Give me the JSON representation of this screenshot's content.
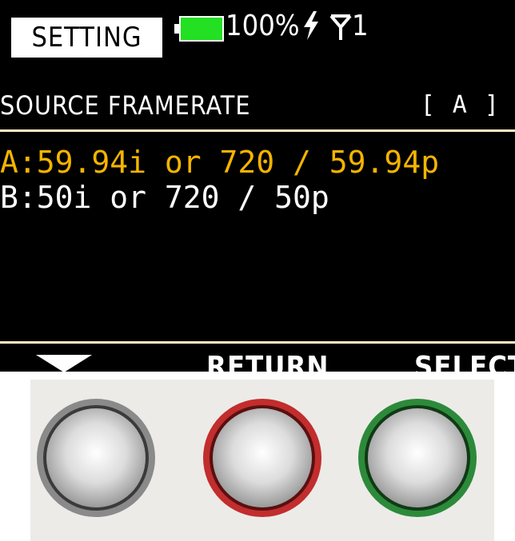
{
  "header": {
    "mode_label": "SETTING",
    "battery_percent": "100%",
    "battery_level": 1.0,
    "battery_color": "#23e023",
    "antenna_label": "1",
    "icons": [
      "battery-icon",
      "lightning-bolt-icon",
      "antenna-icon"
    ]
  },
  "menu": {
    "title": "SOURCE FRAMERATE",
    "current_value": "[ A ]",
    "options": [
      {
        "label": "A:59.94i or 720 / 59.94p",
        "selected": true
      },
      {
        "label": "B:50i or 720 / 50p",
        "selected": false
      }
    ],
    "highlight_color": "#f5b400"
  },
  "softkeys": {
    "left_icon": "down-arrow-icon",
    "center_label": "RETURN",
    "right_label": "SELECT"
  },
  "hardware_buttons": [
    {
      "name": "left-hardware-button",
      "ring_color": "#7c7c7c"
    },
    {
      "name": "center-hardware-button",
      "ring_color": "#c22d2d"
    },
    {
      "name": "right-hardware-button",
      "ring_color": "#2d8a3a"
    }
  ]
}
